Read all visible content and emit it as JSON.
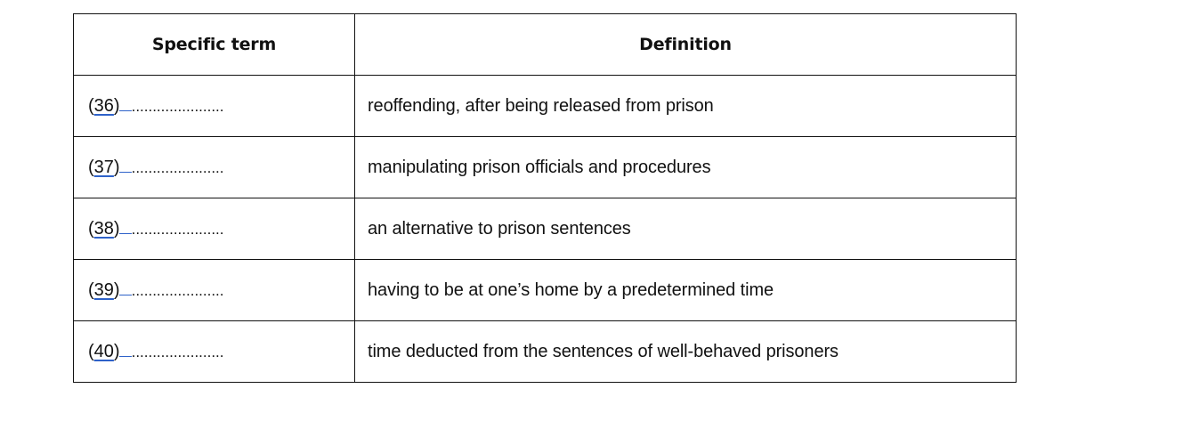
{
  "table": {
    "headers": {
      "term": "Specific term",
      "definition": "Definition"
    },
    "rows": [
      {
        "open": "(",
        "number": "36",
        "close": ")",
        "blank": "......................",
        "definition": "reoffending, after being released from prison"
      },
      {
        "open": "(",
        "number": "37",
        "close": ")",
        "blank": "......................",
        "definition": "manipulating prison officials and procedures"
      },
      {
        "open": "(",
        "number": "38",
        "close": ")",
        "blank": "......................",
        "definition": "an alternative to prison sentences"
      },
      {
        "open": "(",
        "number": "39",
        "close": ")",
        "blank": "......................",
        "definition": "having to be at one’s home by a predetermined time"
      },
      {
        "open": "(",
        "number": "40",
        "close": ")",
        "blank": "......................",
        "definition": "time deducted from the sentences of well-behaved prisoners"
      }
    ]
  },
  "colors": {
    "text": "#111111",
    "border": "#111111",
    "link_underline": "#2e62c9",
    "background": "#ffffff"
  }
}
